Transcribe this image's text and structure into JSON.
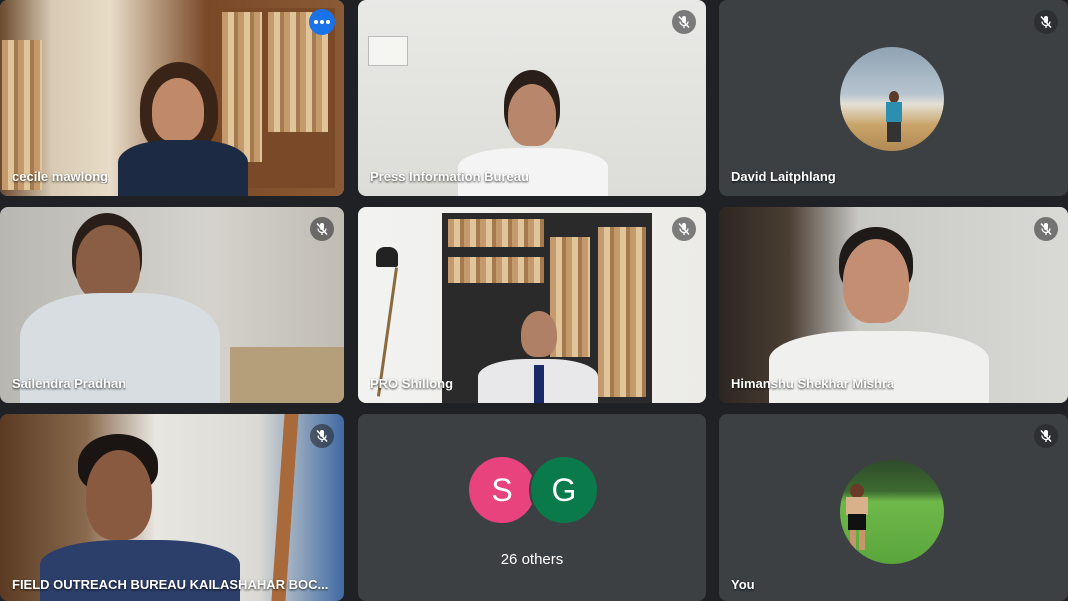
{
  "participants": [
    {
      "name": "cecile mawlong",
      "muted": false,
      "speaking": true,
      "has_more_button": true
    },
    {
      "name": "Press Information Bureau",
      "muted": true
    },
    {
      "name": "David Laitphlang",
      "muted": true,
      "avatar": "beach-photo"
    },
    {
      "name": "Sailendra Pradhan",
      "muted": true
    },
    {
      "name": "PRO Shillong",
      "muted": true
    },
    {
      "name": "Himanshu Shekhar Mishra",
      "muted": true
    },
    {
      "name": "FIELD OUTREACH BUREAU KAILASHAHAR BOC...",
      "muted": true
    },
    {
      "name": "You",
      "muted": true,
      "avatar": "field-photo"
    }
  ],
  "others_tile": {
    "initials": [
      "S",
      "G"
    ],
    "label": "26 others",
    "colors": [
      "#e8437d",
      "#0b7a4b"
    ]
  },
  "colors": {
    "background": "#202124",
    "tile": "#3c4043",
    "active_border": "#8ab4f8",
    "more_button": "#1a73e8"
  },
  "icons": {
    "mute": "mic-off-icon",
    "more": "more-options-icon"
  }
}
